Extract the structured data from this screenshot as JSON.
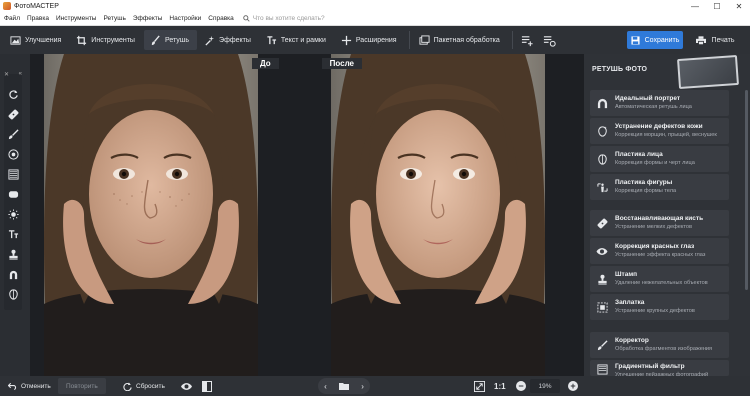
{
  "window": {
    "title": "ФотоМАСТЕР",
    "minimize": "—",
    "maximize": "☐",
    "close": "✕"
  },
  "menu": {
    "items": [
      "Файл",
      "Правка",
      "Инструменты",
      "Ретушь",
      "Эффекты",
      "Настройки",
      "Справка"
    ],
    "search_placeholder": "Что вы хотите сделать?"
  },
  "toolbar": {
    "tabs": [
      {
        "label": "Улучшения",
        "icon": "enhance-icon"
      },
      {
        "label": "Инструменты",
        "icon": "crop-icon"
      },
      {
        "label": "Ретушь",
        "icon": "brush-icon",
        "active": true
      },
      {
        "label": "Эффекты",
        "icon": "sparkle-icon"
      },
      {
        "label": "Текст и рамки",
        "icon": "text-icon"
      },
      {
        "label": "Расширения",
        "icon": "plus-icon"
      },
      {
        "label": "Пакетная обработка",
        "icon": "batch-icon"
      }
    ],
    "save_label": "Сохранить",
    "print_label": "Печать"
  },
  "left_tools": {
    "icons": [
      "rotate-icon",
      "patch-icon",
      "brush-icon",
      "target-icon",
      "gradient-icon",
      "oval-icon",
      "sun-icon",
      "text-tool-icon",
      "stamp-icon",
      "magnet-icon",
      "face-icon"
    ]
  },
  "compare": {
    "before_label": "До",
    "after_label": "После"
  },
  "right_panel": {
    "title": "РЕТУШЬ ФОТО",
    "tools": [
      {
        "title": "Идеальный портрет",
        "subtitle": "Автоматическая ретушь лица",
        "icon": "portrait-icon"
      },
      {
        "title": "Устранение дефектов кожи",
        "subtitle": "Коррекция морщин, прыщей, веснушек",
        "icon": "skin-icon"
      },
      {
        "title": "Пластика лица",
        "subtitle": "Коррекция формы и черт лица",
        "icon": "face-shape-icon"
      },
      {
        "title": "Пластика фигуры",
        "subtitle": "Коррекция формы тела",
        "icon": "body-icon"
      },
      {
        "title": "Восстанавливающая кисть",
        "subtitle": "Устранение мелких дефектов",
        "icon": "healing-brush-icon"
      },
      {
        "title": "Коррекция красных глаз",
        "subtitle": "Устранение эффекта красных глаз",
        "icon": "eye-icon"
      },
      {
        "title": "Штамп",
        "subtitle": "Удаление нежелательных объектов",
        "icon": "stamp-icon"
      },
      {
        "title": "Заплатка",
        "subtitle": "Устранение крупных дефектов",
        "icon": "patch-icon"
      },
      {
        "title": "Корректор",
        "subtitle": "Обработка фрагментов изображения",
        "icon": "corrector-icon"
      },
      {
        "title": "Градиентный фильтр",
        "subtitle": "Улучшение пейзажных фотографий",
        "icon": "gradient-filter-icon"
      }
    ]
  },
  "bottom": {
    "undo_label": "Отменить",
    "redo_label": "Повторить",
    "reset_label": "Сбросить",
    "actual_size_label": "1:1",
    "zoom_value": "19%"
  },
  "colors": {
    "accent": "#2f7ad9",
    "panel": "#2f3237",
    "card": "#393c42",
    "canvas": "#1d1f23"
  }
}
